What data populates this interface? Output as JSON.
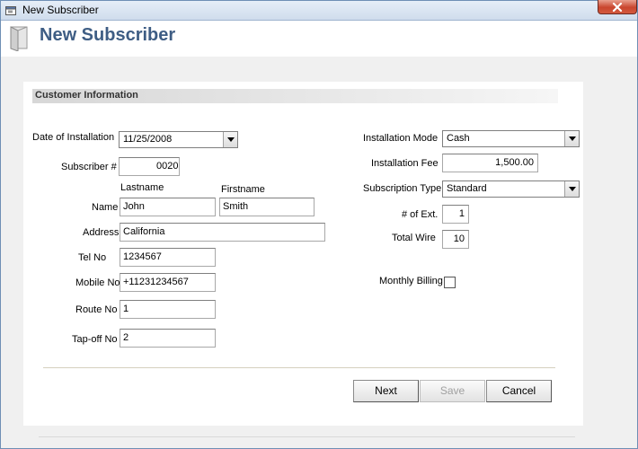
{
  "window": {
    "title": "New Subscriber"
  },
  "header": {
    "title": "New Subscriber"
  },
  "section": {
    "title": "Customer Information"
  },
  "form": {
    "date_label": "Date of Installation",
    "date_value": "11/25/2008",
    "subscriber_label": "Subscriber #",
    "subscriber_value": "0020",
    "lastname_label": "Lastname",
    "firstname_label": "Firstname",
    "name_label": "Name",
    "lastname_value": "John",
    "firstname_value": "Smith",
    "address_label": "Address",
    "address_value": "California",
    "tel_label": "Tel No",
    "tel_value": "1234567",
    "mobile_label": "Mobile No",
    "mobile_value": "+11231234567",
    "route_label": "Route No",
    "route_value": "1",
    "tapoff_label": "Tap-off No",
    "tapoff_value": "2",
    "mode_label": "Installation Mode",
    "mode_value": "Cash",
    "fee_label": "Installation Fee",
    "fee_value": "1,500.00",
    "subtype_label": "Subscription Type",
    "subtype_value": "Standard",
    "ext_label": "# of Ext.",
    "ext_value": "1",
    "wire_label": "Total Wire",
    "wire_value": "10",
    "billing_label": "Monthly Billing",
    "billing_checked": false
  },
  "buttons": {
    "next": "Next",
    "save": "Save",
    "cancel": "Cancel"
  },
  "icons": {
    "title_icon": "window-icon",
    "header_icon": "document-icon",
    "close_icon": "close-icon",
    "dropdown_icon": "chevron-down-icon"
  }
}
